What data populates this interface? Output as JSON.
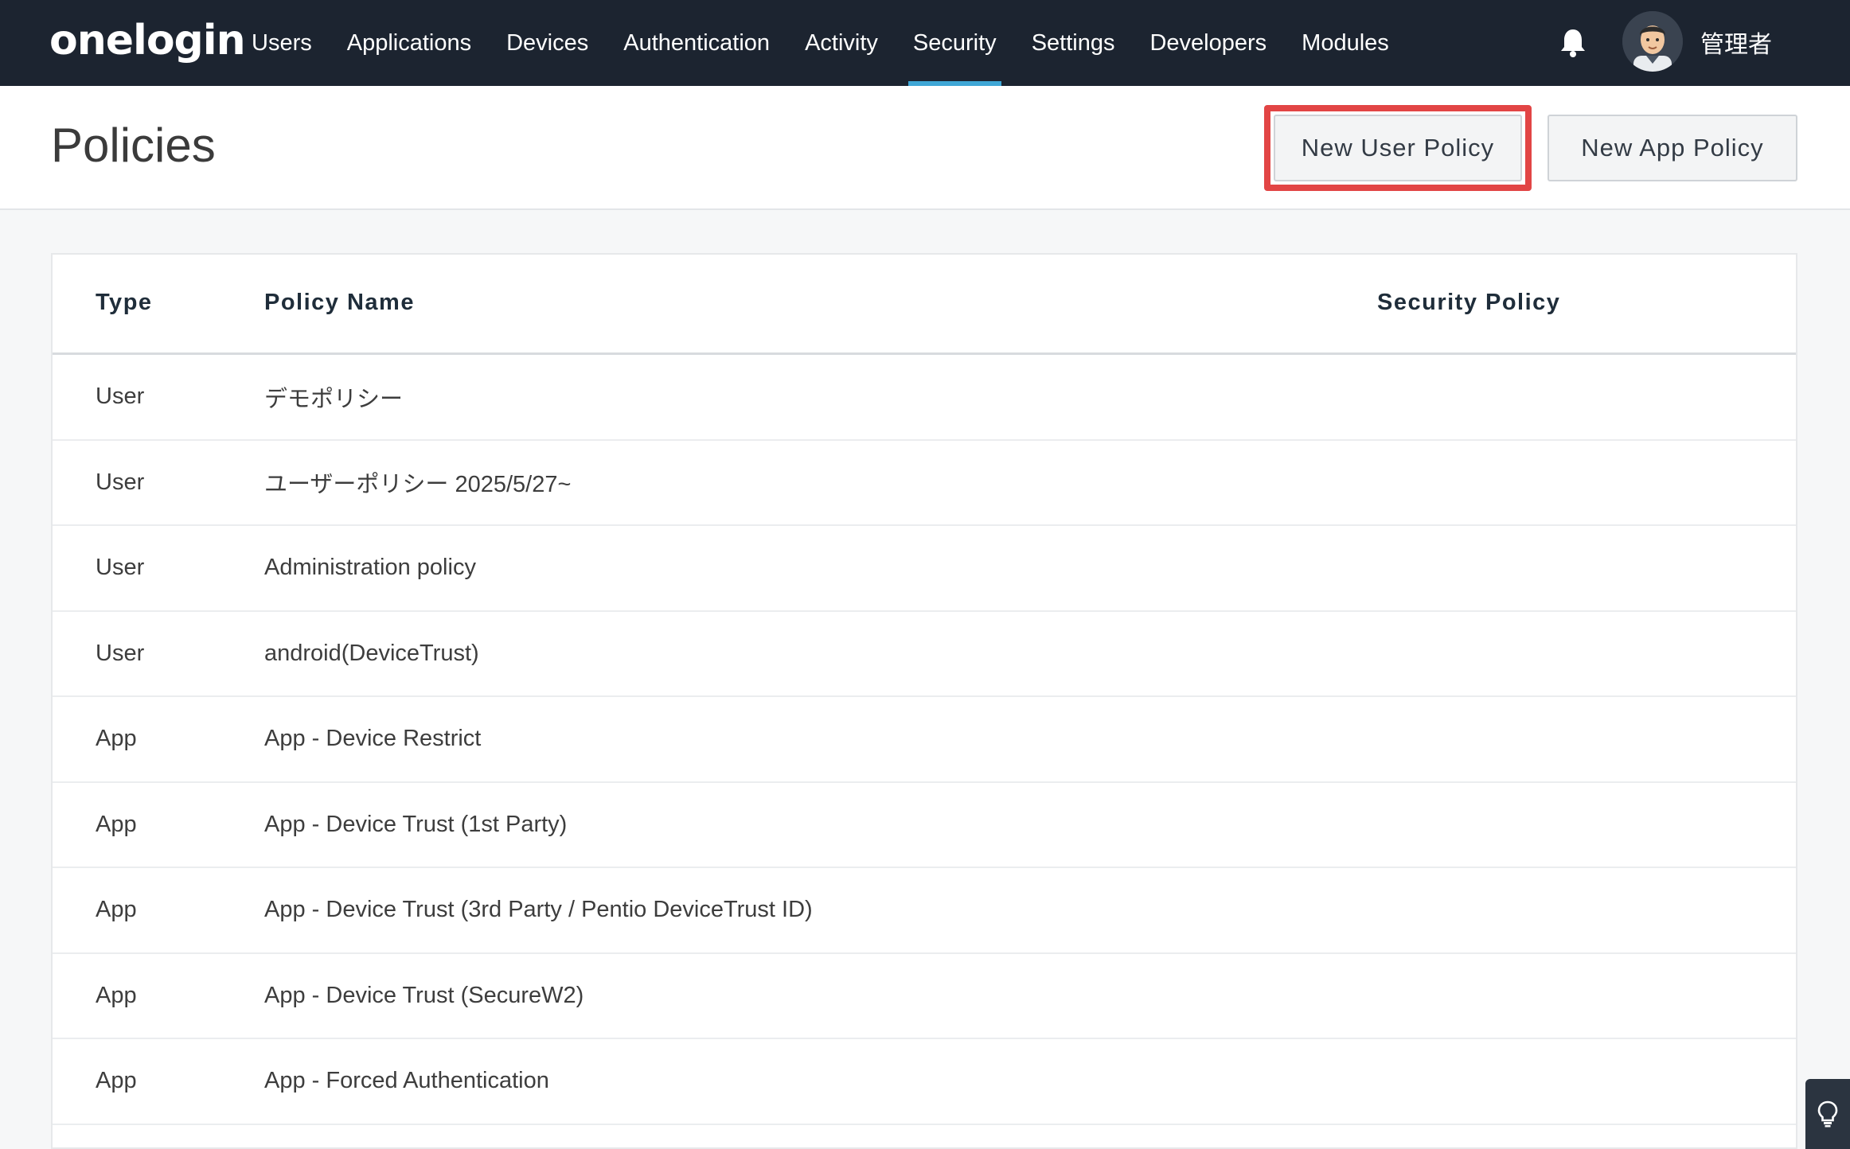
{
  "nav": {
    "logo": "onelogin",
    "items": [
      {
        "label": "Users",
        "active": false
      },
      {
        "label": "Applications",
        "active": false
      },
      {
        "label": "Devices",
        "active": false
      },
      {
        "label": "Authentication",
        "active": false
      },
      {
        "label": "Activity",
        "active": false
      },
      {
        "label": "Security",
        "active": true
      },
      {
        "label": "Settings",
        "active": false
      },
      {
        "label": "Developers",
        "active": false
      },
      {
        "label": "Modules",
        "active": false
      }
    ],
    "icons": {
      "notifications": "bell-icon",
      "profile": "avatar"
    },
    "user_name": "管理者"
  },
  "header": {
    "title": "Policies",
    "new_user_policy_label": "New User Policy",
    "new_app_policy_label": "New App Policy"
  },
  "table": {
    "columns": {
      "type": "Type",
      "name": "Policy Name",
      "security": "Security Policy"
    },
    "rows": [
      {
        "type": "User",
        "name": "デモポリシー"
      },
      {
        "type": "User",
        "name": "ユーザーポリシー 2025/5/27~"
      },
      {
        "type": "User",
        "name": "Administration policy"
      },
      {
        "type": "User",
        "name": "android(DeviceTrust)"
      },
      {
        "type": "App",
        "name": "App - Device Restrict"
      },
      {
        "type": "App",
        "name": "App - Device Trust (1st Party)"
      },
      {
        "type": "App",
        "name": "App - Device Trust (3rd Party / Pentio DeviceTrust ID)"
      },
      {
        "type": "App",
        "name": "App - Device Trust (SecureW2)"
      },
      {
        "type": "App",
        "name": "App - Forced Authentication"
      }
    ]
  },
  "colors": {
    "nav_bg": "#1c2430",
    "active_underline": "#3fa7d6",
    "highlight_border": "#e24545"
  },
  "floating": {
    "hint_icon": "lightbulb-icon"
  }
}
